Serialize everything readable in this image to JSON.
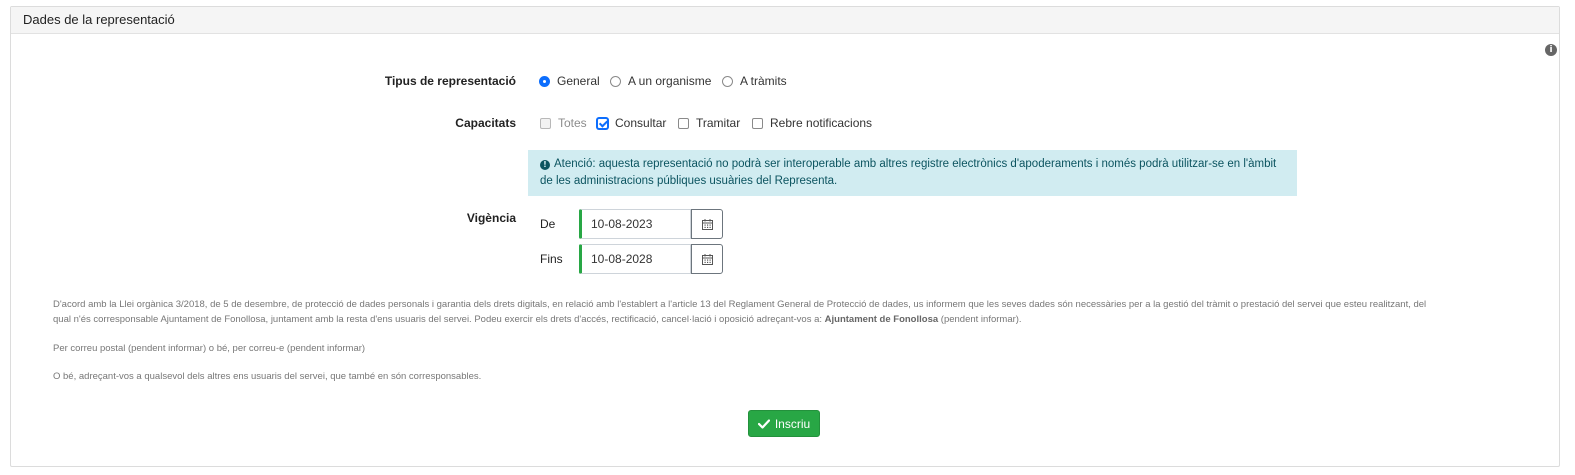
{
  "panel": {
    "title": "Dades de la representació",
    "info_icon": "info-icon"
  },
  "tipus": {
    "label": "Tipus de representació",
    "options": [
      {
        "label": "General",
        "selected": true
      },
      {
        "label": "A un organisme",
        "selected": false
      },
      {
        "label": "A tràmits",
        "selected": false
      }
    ]
  },
  "capacitats": {
    "label": "Capacitats",
    "options": [
      {
        "label": "Totes",
        "checked": false,
        "disabled": true
      },
      {
        "label": "Consultar",
        "checked": true,
        "disabled": false
      },
      {
        "label": "Tramitar",
        "checked": false,
        "disabled": false
      },
      {
        "label": "Rebre notificacions",
        "checked": false,
        "disabled": false
      }
    ]
  },
  "alert": {
    "line1": "Atenció: aquesta representació no podrà ser interoperable amb altres registre electrònics d'apoderaments i només podrà utilitzar-se en l'àmbit",
    "line2": "de les administracions públiques usuàries del Representa.",
    "icon": "exclamation-circle-icon",
    "color_bg": "#d1ecf1",
    "color_text": "#0c5460"
  },
  "vigencia": {
    "label": "Vigència",
    "from_label": "De",
    "from_value": "10-08-2023",
    "to_label": "Fins",
    "to_value": "10-08-2028",
    "calendar_icon": "calendar-icon"
  },
  "legal": {
    "p1_a": "D'acord amb la Llei orgànica 3/2018, de 5 de desembre, de protecció de dades personals i garantia dels drets digitals, en relació amb l'establert a l'article 13 del Reglament General de Protecció de dades, us informem que les seves dades són necessàries per a la gestió del tràmit o prestació del servei que esteu realitzant, del",
    "p1_b": "qual n'és corresponsable Ajuntament de Fonollosa, juntament amb la resta d'ens usuaris del servei. Podeu exercir els drets d'accés, rectificació, cancel·lació i oposició adreçant-vos a: ",
    "p1_bold": "Ajuntament de Fonollosa",
    "p1_c": " (pendent informar).",
    "p2": "Per correu postal (pendent informar) o bé, per correu-e (pendent informar)",
    "p3": "O bé, adreçant-vos a qualsevol dels altres ens usuaris del servei, que també en són corresponsables."
  },
  "submit": {
    "label": "Inscriu",
    "icon": "check-icon",
    "color": "#28a745"
  }
}
